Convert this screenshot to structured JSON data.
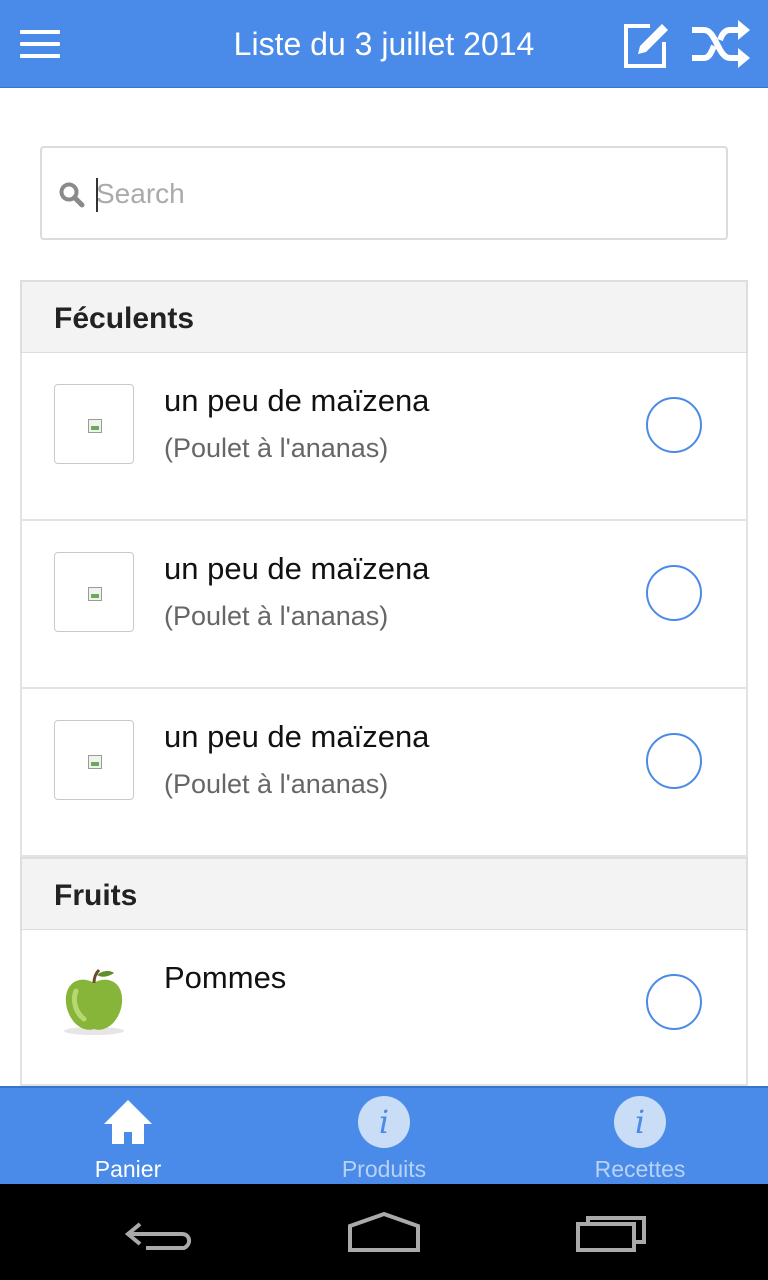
{
  "header": {
    "title": "Liste du 3 juillet 2014",
    "menu_icon": "hamburger-menu-icon",
    "edit_icon": "edit-icon",
    "shuffle_icon": "shuffle-icon"
  },
  "search": {
    "placeholder": "Search",
    "value": ""
  },
  "sections": [
    {
      "title": "Féculents",
      "items": [
        {
          "name": "un peu de maïzena",
          "recipe": "(Poulet à l'ananas)",
          "checked": false
        },
        {
          "name": "un peu de maïzena",
          "recipe": "(Poulet à l'ananas)",
          "checked": false
        },
        {
          "name": "un peu de maïzena",
          "recipe": "(Poulet à l'ananas)",
          "checked": false
        }
      ]
    },
    {
      "title": "Fruits",
      "items": [
        {
          "name": "Pommes",
          "recipe": "",
          "checked": false
        }
      ]
    }
  ],
  "tabs": [
    {
      "label": "Panier",
      "icon": "home-icon",
      "active": true
    },
    {
      "label": "Produits",
      "icon": "info-icon",
      "active": false
    },
    {
      "label": "Recettes",
      "icon": "info-icon",
      "active": false
    }
  ],
  "colors": {
    "accent": "#4a8ae8",
    "section_bg": "#f3f3f3",
    "tab_inactive_text": "#b8d2f6"
  }
}
